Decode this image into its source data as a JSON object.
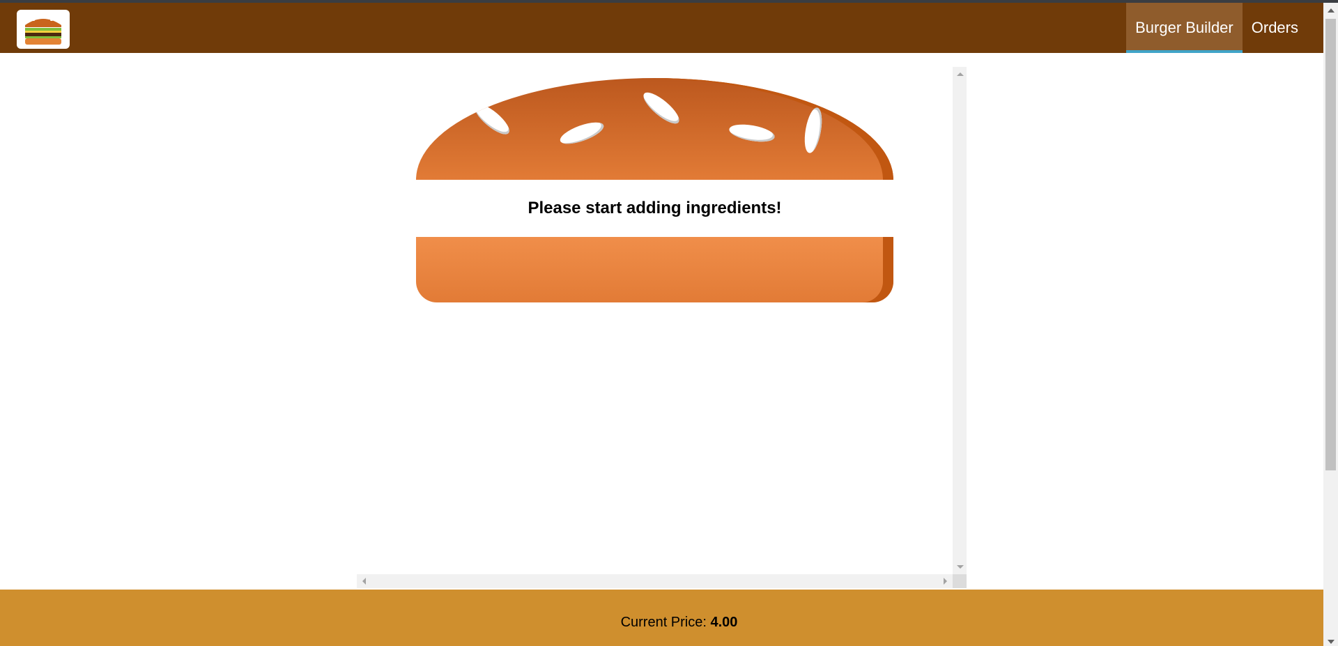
{
  "toolbar": {
    "logo_alt": "burger-logo",
    "nav": [
      {
        "label": "Burger Builder",
        "active": true
      },
      {
        "label": "Orders",
        "active": false
      }
    ]
  },
  "burger": {
    "message": "Please start adding ingredients!"
  },
  "build_controls": {
    "price_label": "Current Price:",
    "price_value": "4.00"
  },
  "colors": {
    "toolbar_bg": "#703b09",
    "nav_active_bg": "#8f5c2c",
    "nav_active_border": "#40a4c8",
    "bun_top": "#bc581e",
    "bun_bottom": "#e27b36",
    "controls_bg": "#cf8f2e"
  }
}
